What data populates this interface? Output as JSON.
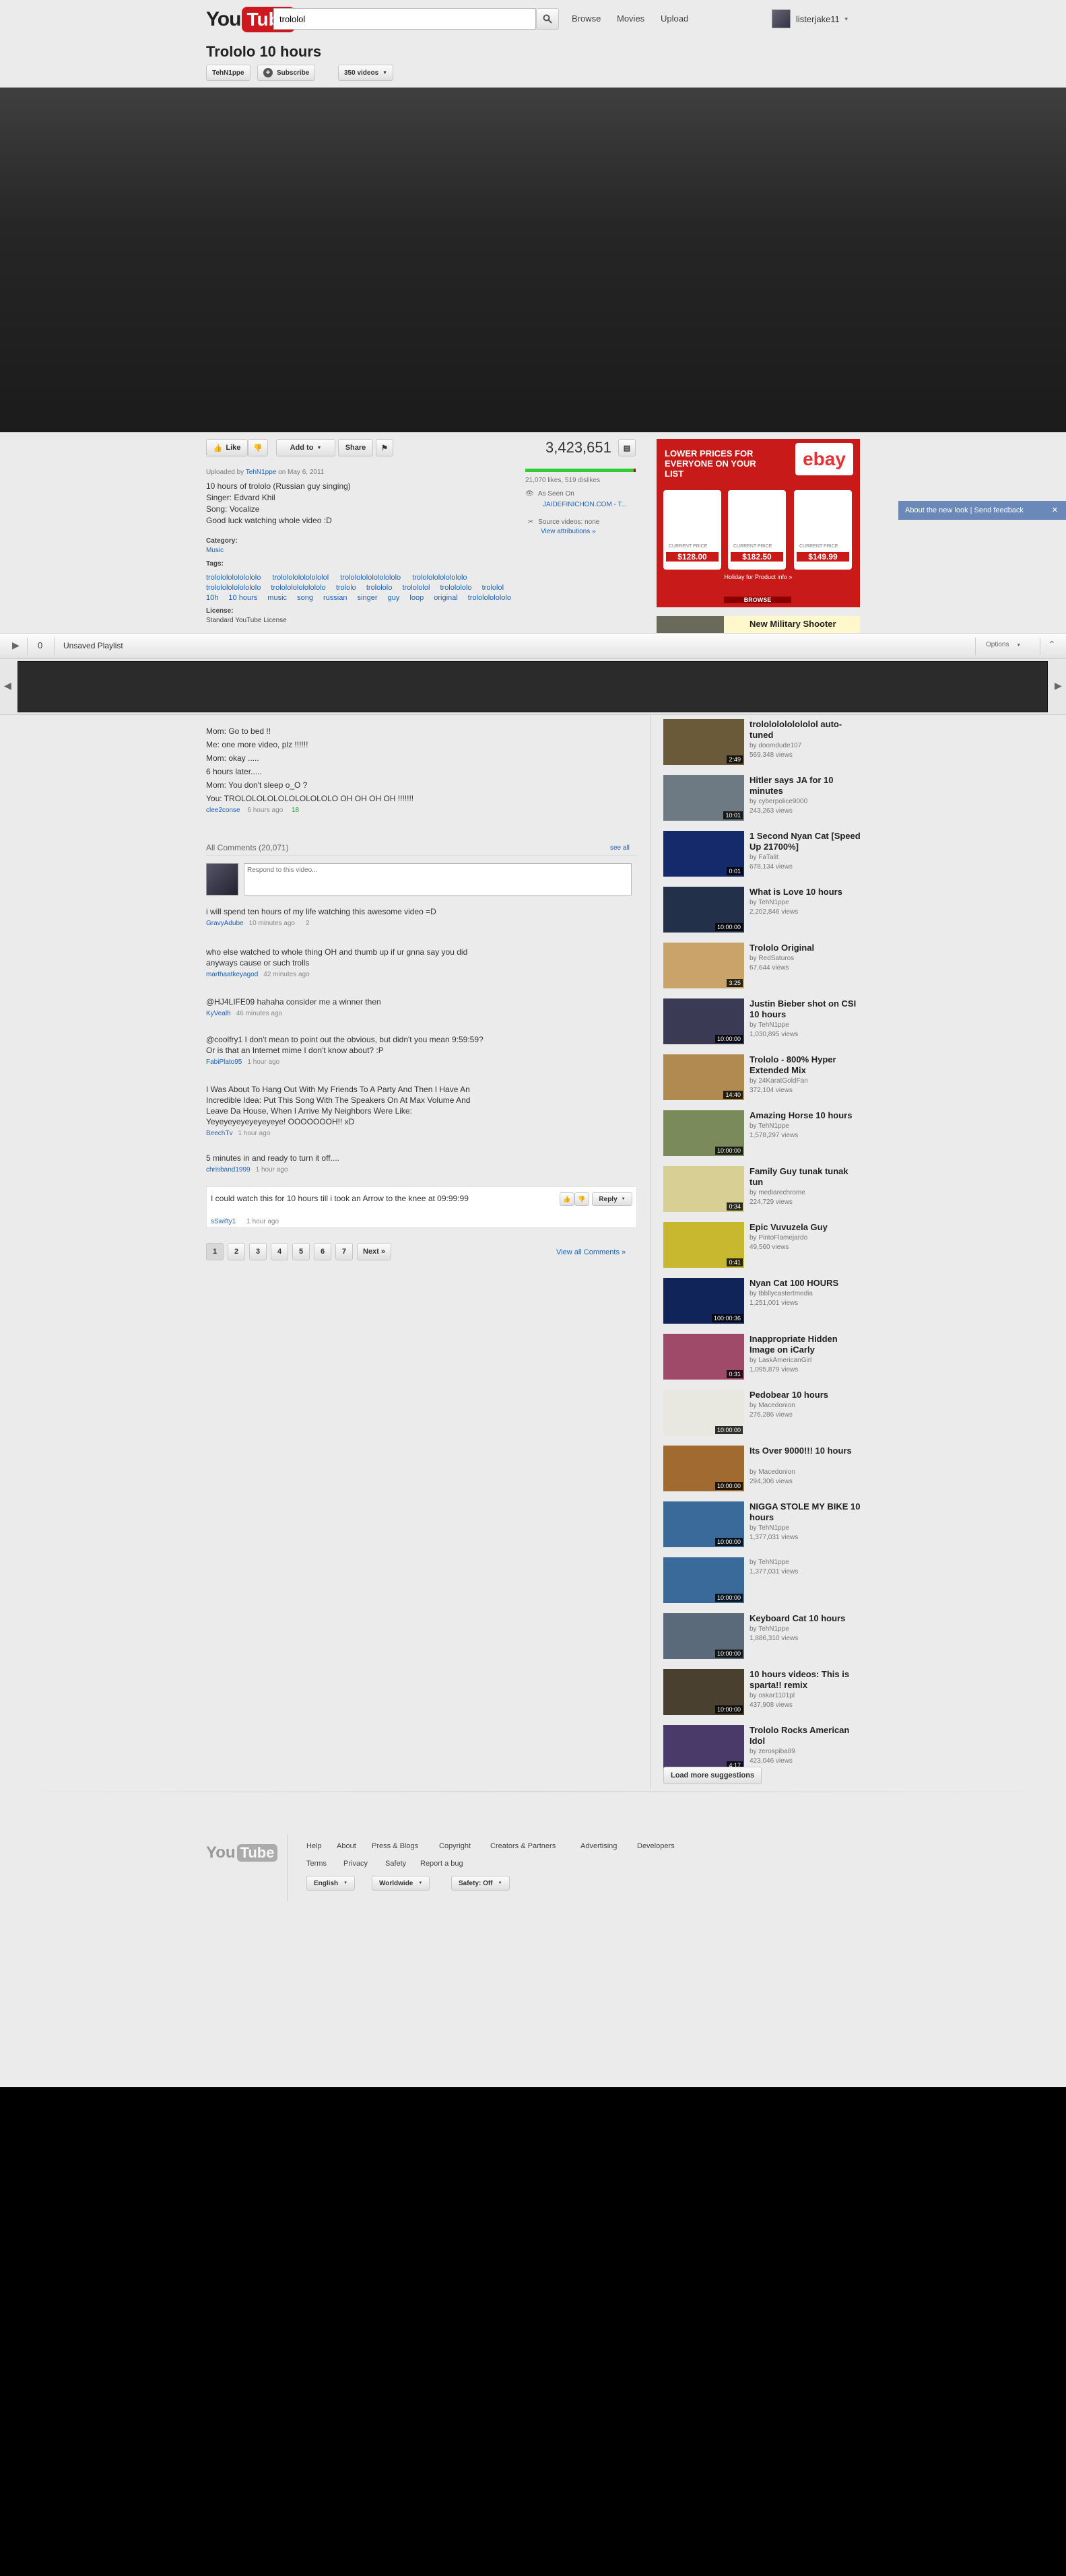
{
  "header": {
    "logo_you": "You",
    "logo_tube": "Tube",
    "search_value": "trololol",
    "nav": [
      "Browse",
      "Movies",
      "Upload"
    ],
    "username": "listerjake11"
  },
  "video": {
    "title": "Trololo 10 hours",
    "channel_button": "TehN1ppe",
    "subscribe": "Subscribe",
    "videos_count": "350 videos",
    "like": "Like",
    "add_to": "Add to",
    "share": "Share",
    "view_count": "3,423,651",
    "likes_dislikes": "21,070 likes, 519 dislikes",
    "uploaded_prefix": "Uploaded by",
    "uploader": "TehN1ppe",
    "uploaded_on": "on May 6, 2011",
    "description": [
      "10 hours of trololo (Russian guy singing)",
      "Singer: Edvard Khil",
      "Song: Vocalize",
      "Good luck watching whole video :D"
    ],
    "category_label": "Category:",
    "category": "Music",
    "tags_label": "Tags:",
    "tags": [
      [
        "trololololololololo",
        "trololololololololol",
        "trolololololololololo",
        "trololololololololo"
      ],
      [
        "trololololololololo",
        "trololololololololo",
        "trololo",
        "trolololo",
        "trolololol",
        "trololololo",
        "trololol"
      ],
      [
        "10h",
        "10 hours",
        "music",
        "song",
        "russian",
        "singer",
        "guy",
        "loop",
        "original",
        "trololololololo"
      ]
    ],
    "license_label": "License:",
    "license": "Standard YouTube License",
    "as_seen_on": "As Seen On",
    "as_seen_site": "JAIDEFINICHON.COM - T...",
    "source_videos": "Source videos: none",
    "view_attributions": "View attributions »"
  },
  "ad": {
    "headline": "LOWER PRICES FOR EVERYONE ON YOUR LIST",
    "brand": "ebay",
    "prices": [
      "$128.00",
      "$182.50",
      "$149.99"
    ],
    "price_label": "CURRENT PRICE",
    "footer": "Holiday for Product info »",
    "browse": "BROWSE"
  },
  "feedback_tab": "About the new look | Send feedback",
  "playlist": {
    "count": "0",
    "name": "Unsaved Playlist",
    "options": "Options"
  },
  "lyrics_comment": [
    "Mom: Go to bed !!",
    "Me: one more video, plz !!!!!!",
    "Mom: okay .....",
    "6 hours later.....",
    "Mom: You don't sleep o_O ?",
    "You: TROLOLOLOLOLOLOLOLOLO OH OH OH OH !!!!!!!"
  ],
  "lyrics_meta": {
    "author": "clee2conse",
    "time": "6 hours ago",
    "votes": "18"
  },
  "comments_section": {
    "header": "All Comments (20,071)",
    "see_all": "see all",
    "placeholder": "Respond to this video...",
    "reply": "Reply",
    "view_all": "View all Comments »",
    "pages": [
      "1",
      "2",
      "3",
      "4",
      "5",
      "6",
      "7"
    ],
    "next": "Next »"
  },
  "comments": [
    {
      "text": [
        "i will spend ten hours of my life watching this awesome video =D"
      ],
      "author": "GravyAdube",
      "time": "10 minutes ago",
      "extra": "2"
    },
    {
      "text": [
        "who else watched to whole thing OH and thumb up if ur gnna say you did",
        "anyways cause or such trolls"
      ],
      "author": "marthaatkeyagod",
      "time": "42 minutes ago",
      "extra": ""
    },
    {
      "text": [
        "@HJ4LIFE09 hahaha consider me a winner then"
      ],
      "author": "KyVealh",
      "time": "46 minutes ago",
      "extra": ""
    },
    {
      "text": [
        "@coolfry1 I don't mean to point out the obvious, but didn't you mean 9:59:59?",
        "Or is that an Internet mime I don't know about? :P"
      ],
      "author": "FabiPlato95",
      "time": "1 hour ago",
      "extra": ""
    },
    {
      "text": [
        "I Was About To Hang Out With My Friends To A Party And Then I Have An",
        "Incredible Idea: Put This Song With The Speakers On At Max Volume And",
        "Leave Da House, When I Arrive My Neighbors Were Like:",
        "Yeyeyeyeyeyeyeyeye! OOOOOOOH!! xD"
      ],
      "author": "BeechTv",
      "time": "1 hour ago",
      "extra": ""
    },
    {
      "text": [
        "5 minutes in and ready to turn it off...."
      ],
      "author": "chrisband1999",
      "time": "1 hour ago",
      "extra": ""
    },
    {
      "text": [
        "I could watch this for 10 hours till i took an Arrow to the knee at 09:99:99"
      ],
      "author": "sSwifty1",
      "time": "1 hour ago",
      "extra": ""
    }
  ],
  "suggestions_top": {
    "title": "New Military Shooter"
  },
  "suggestions": [
    {
      "title": "trolololololololol auto-tuned",
      "by": "by doomdude107",
      "views": "569,348 views",
      "dur": "2:49",
      "color": "#6a5a3a"
    },
    {
      "title": "Hitler says JA for 10 minutes",
      "by": "by cyberpolice9000",
      "views": "243,263 views",
      "dur": "10:01",
      "color": "#6d7a84"
    },
    {
      "title": "1 Second Nyan Cat [Speed Up 21700%]",
      "by": "by FaTalit",
      "views": "678,134 views",
      "dur": "0:01",
      "color": "#142a6a"
    },
    {
      "title": "What is Love 10 hours",
      "by": "by TehN1ppe",
      "views": "2,202,846 views",
      "dur": "10:00:00",
      "color": "#23304a"
    },
    {
      "title": "Trololo Original",
      "by": "by RedSaturos",
      "views": "67,644 views",
      "dur": "3:25",
      "color": "#c9a36a"
    },
    {
      "title": "Justin Bieber shot on CSI 10 hours",
      "by": "by TehN1ppe",
      "views": "1,030,895 views",
      "dur": "10:00:00",
      "color": "#3a3a55"
    },
    {
      "title": "Trololo - 800% Hyper Extended Mix",
      "by": "by 24KaratGoldFan",
      "views": "372,104 views",
      "dur": "14:40",
      "color": "#b08a50"
    },
    {
      "title": "Amazing Horse 10 hours",
      "by": "by TehN1ppe",
      "views": "1,578,297 views",
      "dur": "10:00:00",
      "color": "#7a8a5a"
    },
    {
      "title": "Family Guy tunak tunak tun",
      "by": "by mediarechrome",
      "views": "224,729 views",
      "dur": "0:34",
      "color": "#d8cf95"
    },
    {
      "title": "Epic Vuvuzela Guy",
      "by": "by PintoFlamejardo",
      "views": "49,560 views",
      "dur": "0:41",
      "color": "#c8b830"
    },
    {
      "title": "Nyan Cat 100 HOURS",
      "by": "by tbbllycastertmedia",
      "views": "1,251,001 views",
      "dur": "100:00:36",
      "color": "#10245a"
    },
    {
      "title": "Inappropriate Hidden Image on iCarly",
      "by": "by LaskAmericanGirl",
      "views": "1,095,879 views",
      "dur": "0:31",
      "color": "#a04a6a"
    },
    {
      "title": "Pedobear 10 hours",
      "by": "by Macedonion",
      "views": "276,286 views",
      "dur": "10:00:00",
      "color": "#e8e8e0"
    },
    {
      "title": "Its Over 9000!!! 10 hours",
      "by": "by Macedonion",
      "views": "294,306 views",
      "dur": "10:00:00",
      "color": "#a06a30"
    },
    {
      "title": "NIGGA STOLE MY BIKE 10 hours",
      "by": "by TehN1ppe",
      "views": "1,377,031 views",
      "dur": "10:00:00",
      "color": "#3a6a9a"
    },
    {
      "title": "",
      "by": "by TehN1ppe",
      "views": "1,377,031 views",
      "dur": "10:00:00",
      "color": "#3a6a9a"
    },
    {
      "title": "Keyboard Cat 10 hours",
      "by": "by TehN1ppe",
      "views": "1,886,310 views",
      "dur": "10:00:00",
      "color": "#5a6a7a"
    },
    {
      "title": "10 hours videos: This is sparta!! remix",
      "by": "by oskar1101pl",
      "views": "437,908 views",
      "dur": "10:00:00",
      "color": "#4a4030"
    },
    {
      "title": "Trololo Rocks American Idol",
      "by": "by zerospiba89",
      "views": "423,046 views",
      "dur": "4:17",
      "color": "#4a3a6a"
    }
  ],
  "load_more": "Load more suggestions",
  "footer": {
    "logo_you": "You",
    "logo_tube": "Tube",
    "links": [
      "Help",
      "About",
      "Press & Blogs",
      "Copyright",
      "Creators & Partners",
      "Advertising",
      "Developers"
    ],
    "links2": [
      "Terms",
      "Privacy",
      "Safety",
      "Report a bug"
    ],
    "language": "English",
    "location": "Worldwide",
    "safety": "Safety: Off"
  }
}
